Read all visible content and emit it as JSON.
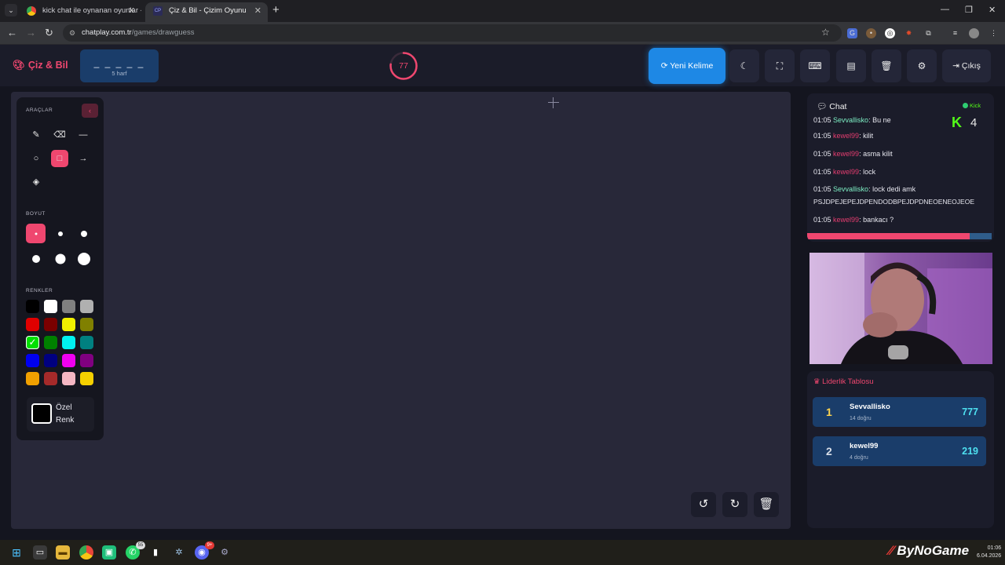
{
  "browser": {
    "tabs": [
      {
        "title": "kick chat ile oynanan oyunlar -",
        "active": false
      },
      {
        "title": "Çiz & Bil - Çizim Oyunu",
        "active": true
      }
    ],
    "url": {
      "host": "chatplay.com.tr",
      "path": "/games/drawguess"
    }
  },
  "header": {
    "brand": "Çiz & Bil",
    "word_mask": "_ _ _ _ _",
    "word_length": "5 harf",
    "timer": "77",
    "timer_fraction": 0.77,
    "new_word_label": "Yeni Kelime",
    "exit_label": "Çıkış",
    "accent_color": "#ef476f",
    "primary_color": "#1e88e5"
  },
  "tools": {
    "tools_label": "ARAÇLAR",
    "size_label": "BOYUT",
    "colors_label": "RENKLER",
    "custom_color_label": "Özel Renk",
    "colors": [
      "#000000",
      "#ffffff",
      "#808080",
      "#b0b0b0",
      "#e00000",
      "#7a0000",
      "#f0f000",
      "#808000",
      "#00e000",
      "#008000",
      "#00f0f0",
      "#008080",
      "#0000f0",
      "#000080",
      "#f000f0",
      "#800080",
      "#f0a000",
      "#a52a2a",
      "#f4b6c2",
      "#f5d000"
    ]
  },
  "chat": {
    "title": "Chat",
    "platform": "Kick",
    "viewer_count": "4",
    "messages": [
      {
        "time": "01:05",
        "user": "Sevvallisko",
        "text": ": Bu ne"
      },
      {
        "time": "01:05",
        "user": "kewel99",
        "text": ": kilit"
      },
      {
        "time": "01:05",
        "user": "kewel99",
        "text": ": asma kilit"
      },
      {
        "time": "01:05",
        "user": "kewel99",
        "text": ": lock"
      },
      {
        "time": "01:05",
        "user": "Sevvallisko",
        "text": ": lock dedi amk"
      },
      {
        "time": "",
        "user": "",
        "text": "PSJDPEJEPEJDPENDODBPEJDPDNEOENEOJEOE"
      },
      {
        "time": "01:05",
        "user": "kewel99",
        "text": ": bankacı ?"
      }
    ],
    "progress_fraction": 0.88
  },
  "leaderboard": {
    "title": "Liderlik Tablosu",
    "rows": [
      {
        "rank": "1",
        "name": "Sevvallisko",
        "correct": "14 doğru",
        "points": "777"
      },
      {
        "rank": "2",
        "name": "kewel99",
        "correct": "4 doğru",
        "points": "219"
      }
    ]
  },
  "taskbar": {
    "whatsapp_badge": "55",
    "discord_badge": "9+",
    "watermark": "ByNoGame",
    "clock_time": "01:06",
    "clock_date": "6.04.2026"
  }
}
